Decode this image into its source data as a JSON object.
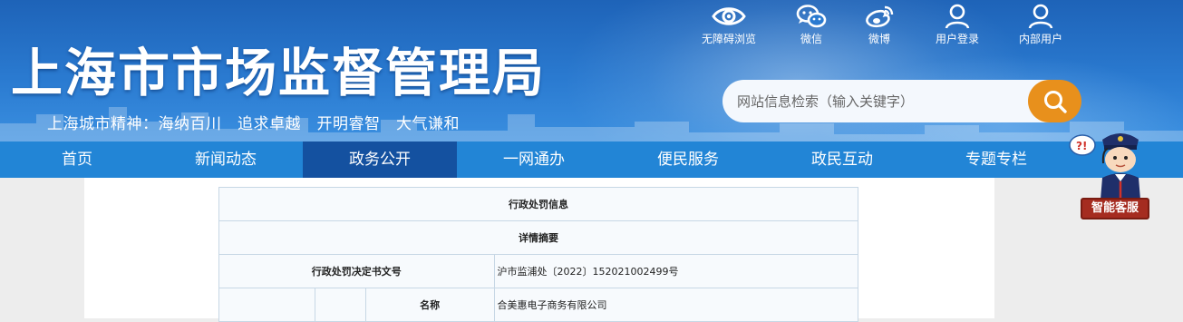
{
  "header": {
    "title": "上海市市场监督管理局",
    "slogan": "上海城市精神：海纳百川　追求卓越　开明睿智　大气谦和"
  },
  "toplinks": [
    {
      "label": "无障碍浏览",
      "icon": "eye-icon"
    },
    {
      "label": "微信",
      "icon": "wechat-icon"
    },
    {
      "label": "微博",
      "icon": "weibo-icon"
    },
    {
      "label": "用户登录",
      "icon": "user-icon"
    },
    {
      "label": "内部用户",
      "icon": "user-icon"
    }
  ],
  "search": {
    "placeholder": "网站信息检索（输入关键字）",
    "button_icon": "search-icon",
    "button_color": "#e8901c"
  },
  "nav": {
    "items": [
      {
        "label": "首页"
      },
      {
        "label": "新闻动态"
      },
      {
        "label": "政务公开"
      },
      {
        "label": "一网通办"
      },
      {
        "label": "便民服务"
      },
      {
        "label": "政民互动"
      },
      {
        "label": "专题专栏"
      }
    ],
    "active_index": 2,
    "bar_color": "#2285d6",
    "active_color": "#1451a0"
  },
  "service": {
    "label": "智能客服",
    "icon": "customer-service-robot-icon"
  },
  "table": {
    "title": "行政处罚信息",
    "subtitle": "详情摘要",
    "doc_number_label": "行政处罚决定书文号",
    "doc_number_value": "沪市监浦处〔2022〕152021002499号",
    "name_label": "名称",
    "name_value": "合美惠电子商务有限公司"
  }
}
